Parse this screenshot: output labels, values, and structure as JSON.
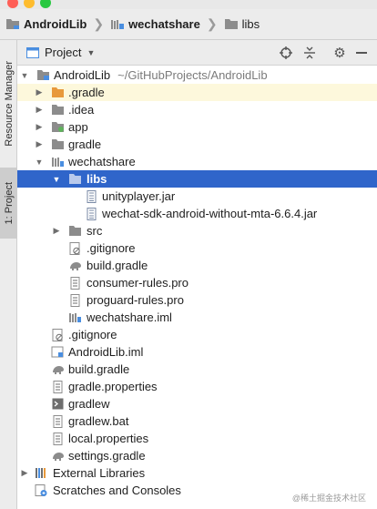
{
  "navbar": {
    "crumbs": [
      {
        "label": "AndroidLib",
        "icon": "folder-module-icon"
      },
      {
        "label": "wechatshare",
        "icon": "folder-module-icon"
      },
      {
        "label": "libs",
        "icon": "folder-icon"
      }
    ]
  },
  "stripe": {
    "resource_manager": "Resource Manager",
    "project_tab": "1: Project"
  },
  "panel": {
    "title": "Project"
  },
  "tree": {
    "root": {
      "label": "AndroidLib",
      "path": "~/GitHubProjects/AndroidLib"
    },
    "gradle_dir": ".gradle",
    "idea": ".idea",
    "app": "app",
    "gradle": "gradle",
    "wechatshare": "wechatshare",
    "libs": "libs",
    "jar1": "unityplayer.jar",
    "jar2": "wechat-sdk-android-without-mta-6.6.4.jar",
    "src": "src",
    "ws_gitignore": ".gitignore",
    "ws_build": "build.gradle",
    "consumer": "consumer-rules.pro",
    "proguard": "proguard-rules.pro",
    "ws_iml": "wechatshare.iml",
    "gitignore": ".gitignore",
    "root_iml": "AndroidLib.iml",
    "build": "build.gradle",
    "gradle_props": "gradle.properties",
    "gradlew": "gradlew",
    "gradlew_bat": "gradlew.bat",
    "local_props": "local.properties",
    "settings": "settings.gradle",
    "external": "External Libraries",
    "scratches": "Scratches and Consoles"
  },
  "watermark": "@稀土掘金技术社区",
  "colors": {
    "selection": "#2f65ca",
    "highlight_row": "#fdf8dc",
    "folder_orange": "#e8993c",
    "folder_gray": "#8c8c8c",
    "module_blue": "#4a8ee0",
    "traffic_red": "#ff5f57",
    "traffic_yellow": "#febc2e",
    "traffic_green": "#28c840"
  }
}
